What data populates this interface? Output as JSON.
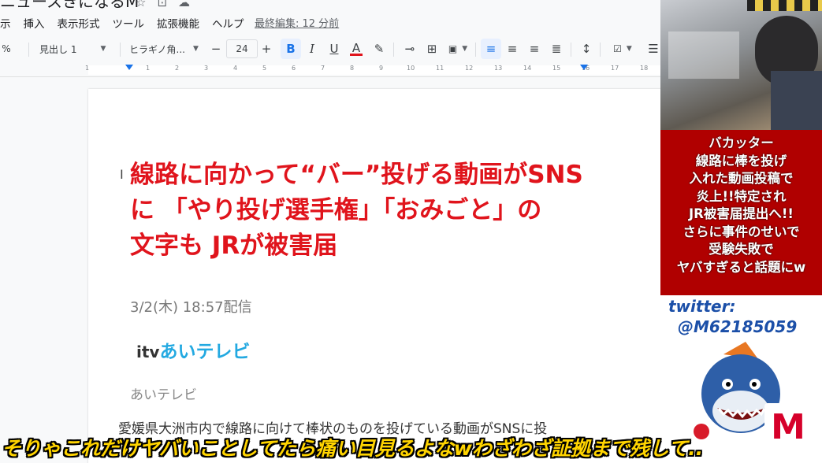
{
  "doc": {
    "title": "ニュースきになるM",
    "menus": [
      "示",
      "挿入",
      "表示形式",
      "ツール",
      "拡張機能",
      "ヘルプ"
    ],
    "last_edit": "最終編集: 12 分前"
  },
  "toolbar": {
    "zoom_suffix": "%",
    "style": "見出し 1",
    "font": "ヒラギノ角...",
    "font_size": "24",
    "minus": "−",
    "plus": "+",
    "bold": "B",
    "italic": "I",
    "underline": "U",
    "text_color": "A",
    "text_color_hex": "#e0141c"
  },
  "ruler": {
    "marks": [
      "1",
      "1",
      "2",
      "3",
      "4",
      "5",
      "6",
      "7",
      "8",
      "9",
      "10",
      "11",
      "12",
      "13",
      "14",
      "15",
      "16",
      "17",
      "18"
    ]
  },
  "article": {
    "headline": [
      "線路に向かって“バー”投げる動画がSNS",
      "に 「やり投げ選手権」「おみごと」の",
      "文字も JRが被害届"
    ],
    "date": "3/2(木) 18:57配信",
    "logo_itv": "itv",
    "logo_ai": "あいテレビ",
    "source": "あいテレビ",
    "body": "愛媛県大洲市内で線路に向けて棒状のものを投げている動画がSNSに投"
  },
  "side": {
    "red_box": [
      "バカッター",
      "線路に棒を投げ",
      "入れた動画投稿で",
      "炎上!!特定され",
      "JR被害届提出へ!!",
      "さらに事件のせいで",
      "受験失敗で",
      "ヤバすぎると話題にw"
    ],
    "twitter_label": "twitter:",
    "twitter_handle": "@M62185059",
    "m_logo": "M"
  },
  "subtitle": "そりゃこれだけヤバいことしてたら痛い目見るよなwわざわざ証拠まで残して.."
}
